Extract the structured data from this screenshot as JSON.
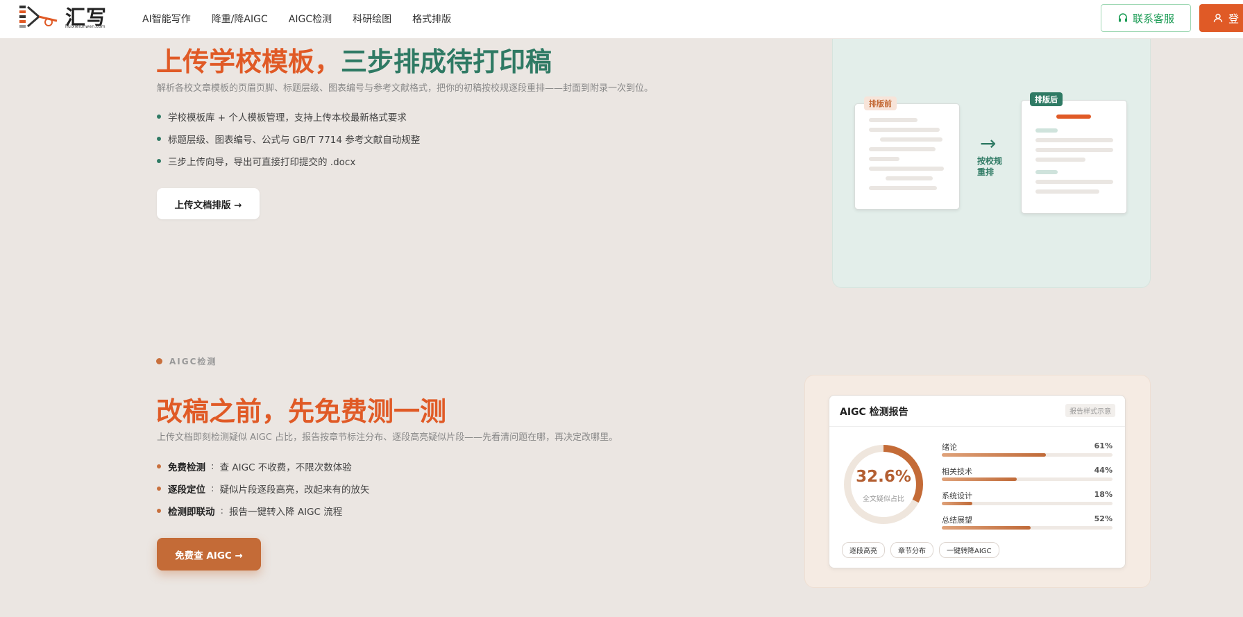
{
  "header": {
    "logo_name": "汇写",
    "logo_domain": "huixielunwen.com",
    "nav": [
      "AI智能写作",
      "降重/降AIGC",
      "AIGC检测",
      "科研绘图",
      "格式排版"
    ],
    "service_label": "联系客服",
    "login_label": "登"
  },
  "format_section": {
    "title_part1": "上传学校模板，",
    "title_part2": "三步排成待打印稿",
    "subtitle": "解析各校文章模板的页眉页脚、标题层级、图表编号与参考文献格式，把你的初稿按校规逐段重排——封面到附录一次到位。",
    "bullets": [
      "学校模板库 + 个人模板管理，支持上传本校最新格式要求",
      "标题层级、图表编号、公式与 GB/T 7714 参考文献自动规整",
      "三步上传向导，导出可直接打印提交的 .docx"
    ],
    "bullet_color": "#2f7a64",
    "cta": "上传文档排版 →",
    "illustration": {
      "before_tag": "排版前",
      "after_tag": "排版后",
      "arrow": "→",
      "arrow_label": "按校规重排"
    }
  },
  "aigc_section": {
    "eyebrow": "AIGC检测",
    "title": "改稿之前，先免费测一测",
    "subtitle": "上传文档即刻检测疑似 AIGC 占比，报告按章节标注分布、逐段高亮疑似片段——先看清问题在哪，再决定改哪里。",
    "bullets": [
      {
        "key": "免费检测",
        "sep": ":",
        "text": "查 AIGC 不收费，不限次数体验"
      },
      {
        "key": "逐段定位",
        "sep": ":",
        "text": "疑似片段逐段高亮，改起来有的放矢"
      },
      {
        "key": "检测即联动",
        "sep": ":",
        "text": "报告一键转入降 AIGC 流程"
      }
    ],
    "bullet_color": "#c8703d",
    "cta": "免费查 AIGC →",
    "report": {
      "title": "AIGC 检测报告",
      "badge": "报告样式示意",
      "ring_value": "32.6%",
      "ring_fraction": 0.326,
      "ring_caption": "全文疑似占比",
      "bars": [
        {
          "label": "绪论",
          "pct": "61%",
          "value": 0.61
        },
        {
          "label": "相关技术",
          "pct": "44%",
          "value": 0.44
        },
        {
          "label": "系统设计",
          "pct": "18%",
          "value": 0.18
        },
        {
          "label": "总结展望",
          "pct": "52%",
          "value": 0.52
        }
      ],
      "chips": [
        "逐段高亮",
        "章节分布",
        "一键转降AIGC"
      ]
    }
  },
  "colors": {
    "brand_orange": "#e05a26",
    "brand_green": "#2f7a64",
    "service_green": "#1b9c55",
    "aigc_brown": "#c46b37"
  }
}
